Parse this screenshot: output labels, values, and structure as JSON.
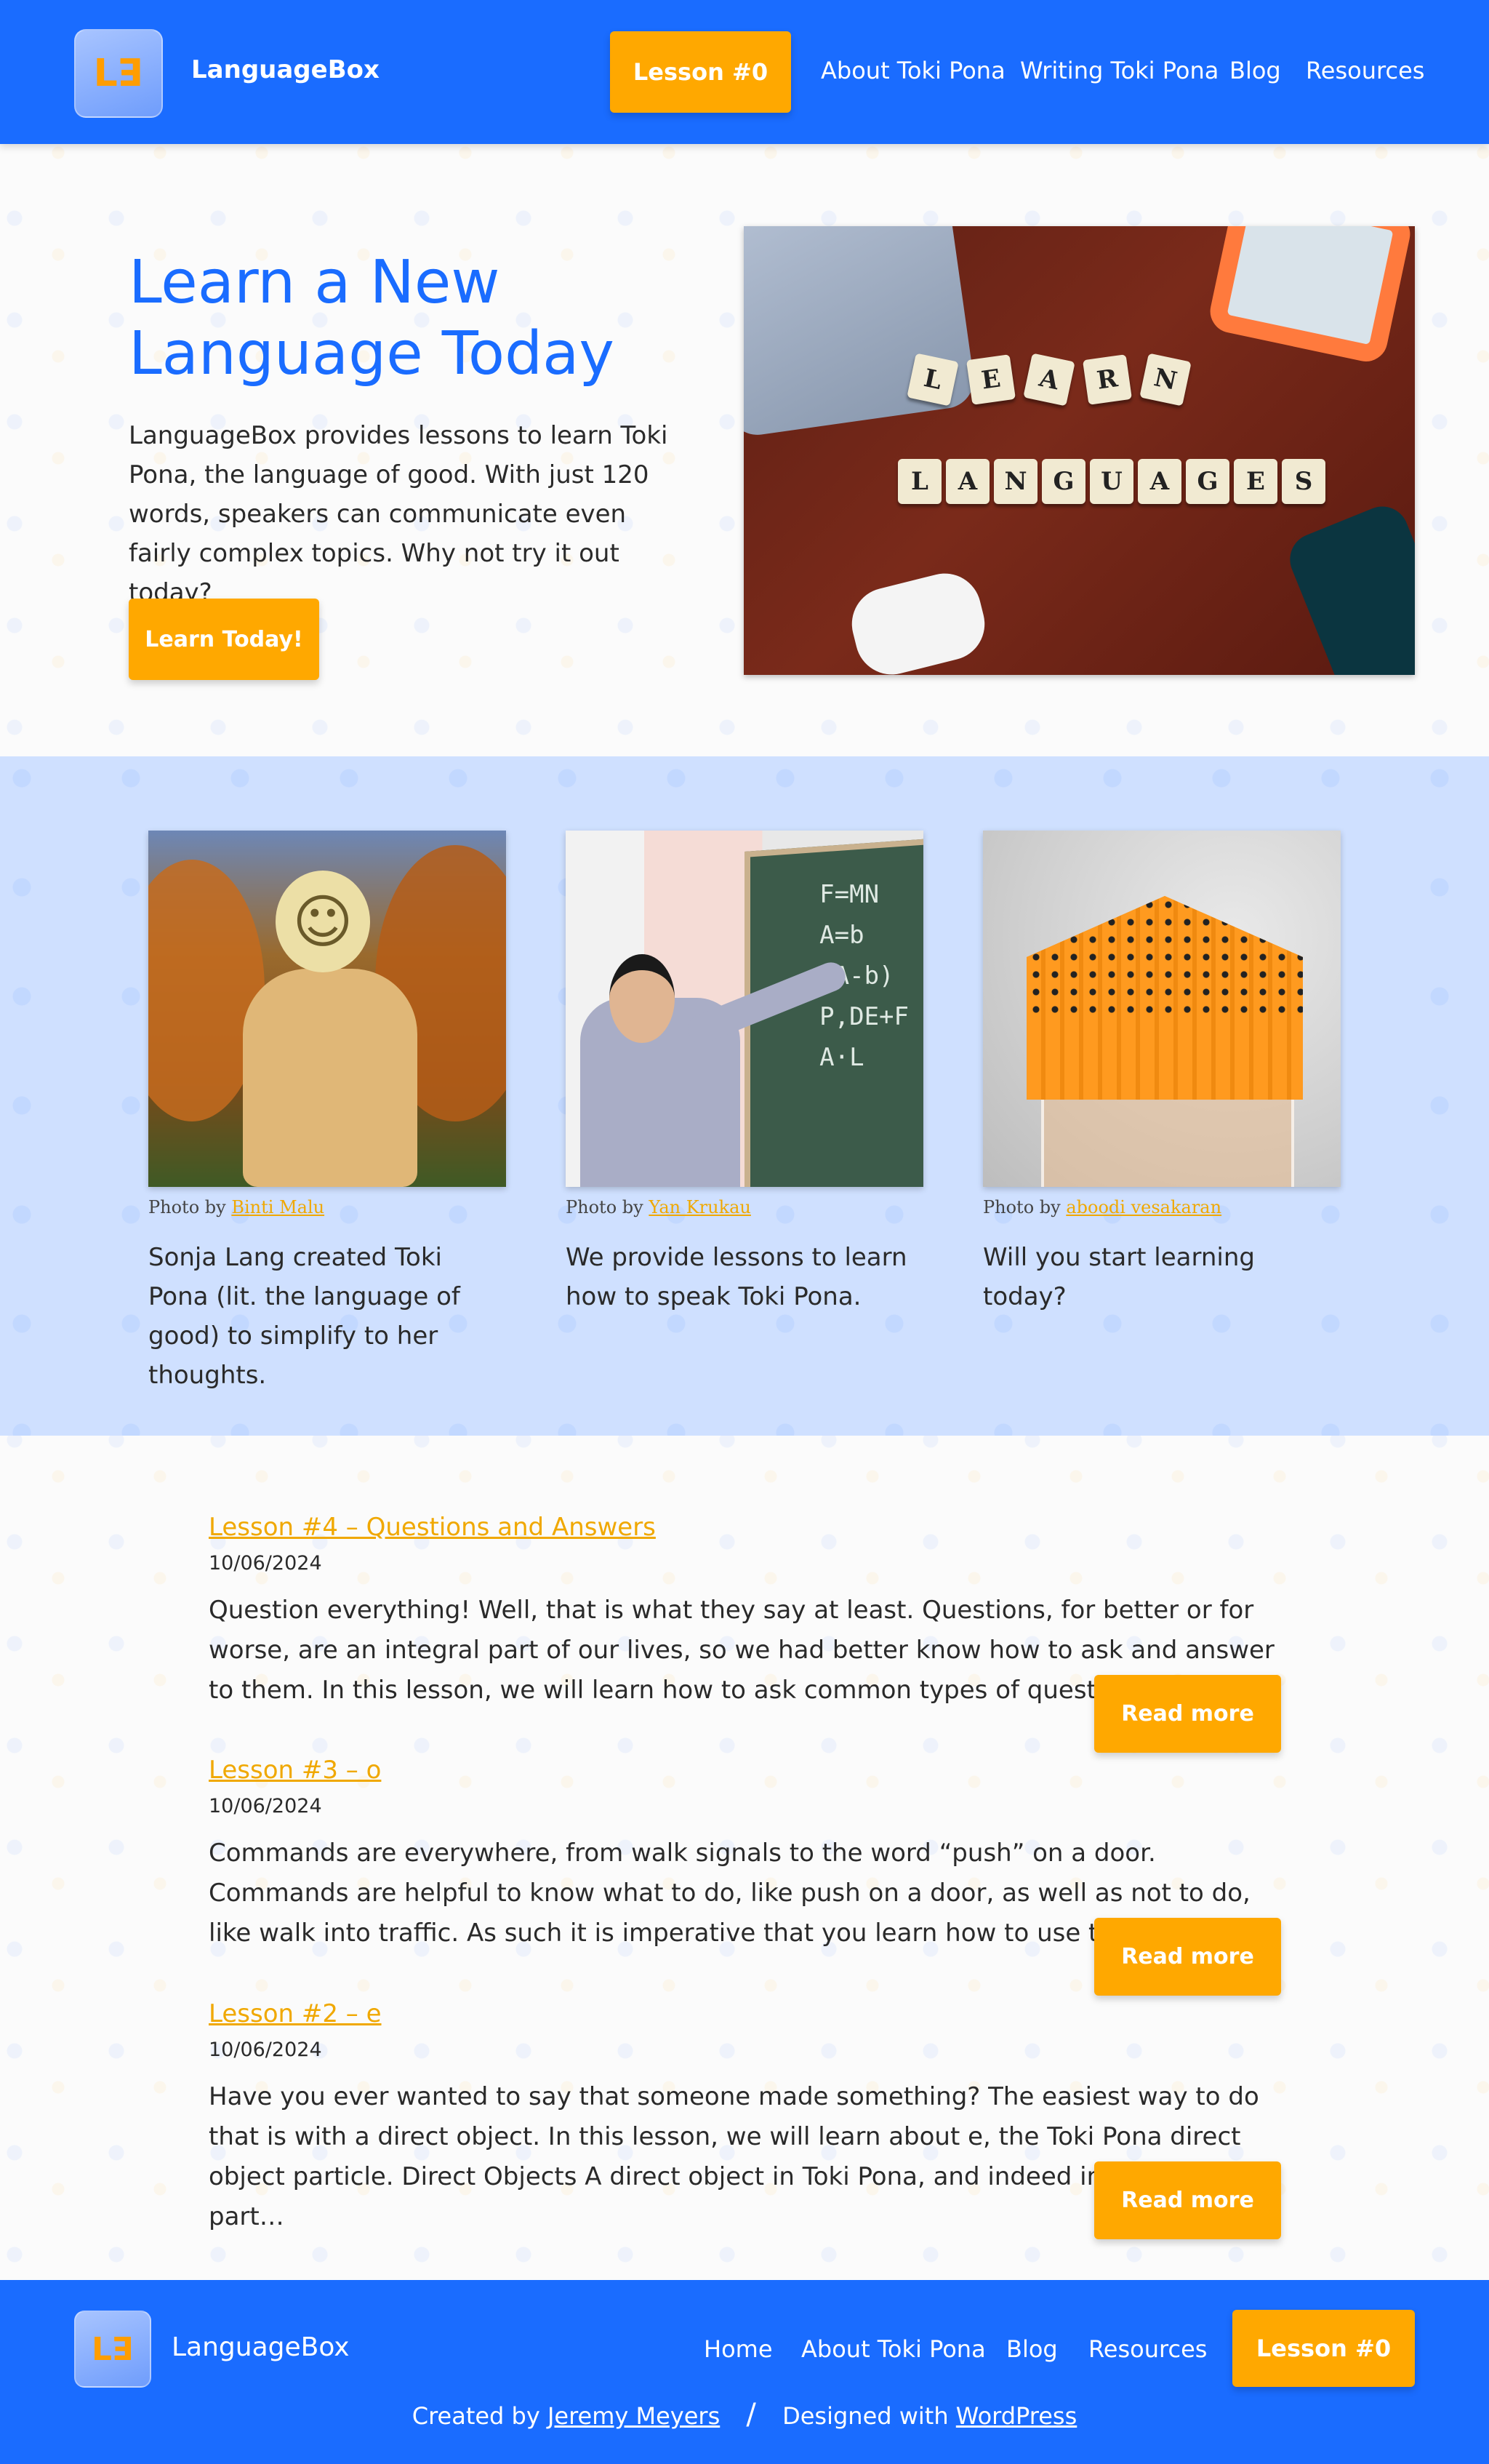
{
  "header": {
    "logo_text": "ꓡꓱ",
    "brand": "LanguageBox",
    "lesson_button": "Lesson #0",
    "nav": [
      "About Toki Pona",
      "Writing Toki Pona",
      "Blog",
      "Resources"
    ]
  },
  "hero": {
    "title": "Learn a New Language Today",
    "text": "LanguageBox provides lessons to learn Toki Pona, the language of good. With just 120 words, speakers can communicate even fairly complex topics. Why not try it out today?",
    "button": "Learn Today!",
    "image_tiles_top": [
      "L",
      "E",
      "A",
      "R",
      "N"
    ],
    "image_tiles_bottom": [
      "L",
      "A",
      "N",
      "G",
      "U",
      "A",
      "G",
      "E",
      "S"
    ]
  },
  "features": [
    {
      "credit_prefix": "Photo by",
      "credit_name": "Binti Malu",
      "text": "Sonja Lang created Toki Pona (lit. the language of good) to simplify to her thoughts."
    },
    {
      "credit_prefix": "Photo by",
      "credit_name": "Yan Krukau",
      "text": "We provide lessons to learn how to speak Toki Pona."
    },
    {
      "credit_prefix": "Photo by",
      "credit_name": "aboodi vesakaran",
      "text": "Will you start learning today?"
    }
  ],
  "posts": [
    {
      "title": "Lesson #4 – Questions and Answers",
      "date": "10/06/2024",
      "excerpt": "Question everything! Well, that is what they say at least. Questions, for better or for worse, are an integral part of our lives, so we had better know how to ask and answer to them. In this lesson, we will learn how to ask common types of questions, as well…",
      "read_more": "Read more"
    },
    {
      "title": "Lesson #3 – o",
      "date": "10/06/2024",
      "excerpt": "Commands are everywhere, from walk signals to the word “push” on a door. Commands are helpful to know what to do, like push on a door, as well as not to do, like walk into traffic. As such it is imperative that you learn how to use them. In this…",
      "read_more": "Read more"
    },
    {
      "title": "Lesson #2 – e",
      "date": "10/06/2024",
      "excerpt": "Have you ever wanted to say that someone made something? The easiest way to do that is with a direct object. In this lesson, we will learn about e, the Toki Pona direct object particle. Direct Objects A direct object in Toki Pona, and indeed in English, is a part…",
      "read_more": "Read more"
    }
  ],
  "footer": {
    "logo_text": "ꓡꓱ",
    "brand": "LanguageBox",
    "nav": [
      "Home",
      "About Toki Pona",
      "Blog",
      "Resources"
    ],
    "lesson_button": "Lesson #0",
    "created_by_prefix": "Created by",
    "created_by_name": "Jeremy Meyers",
    "separator": "/",
    "designed_with_prefix": "Designed with",
    "designed_with_name": "WordPress"
  },
  "colors": {
    "primary_blue": "#1a6cff",
    "accent_orange": "#ffa800",
    "band_blue": "#cfe0ff"
  }
}
